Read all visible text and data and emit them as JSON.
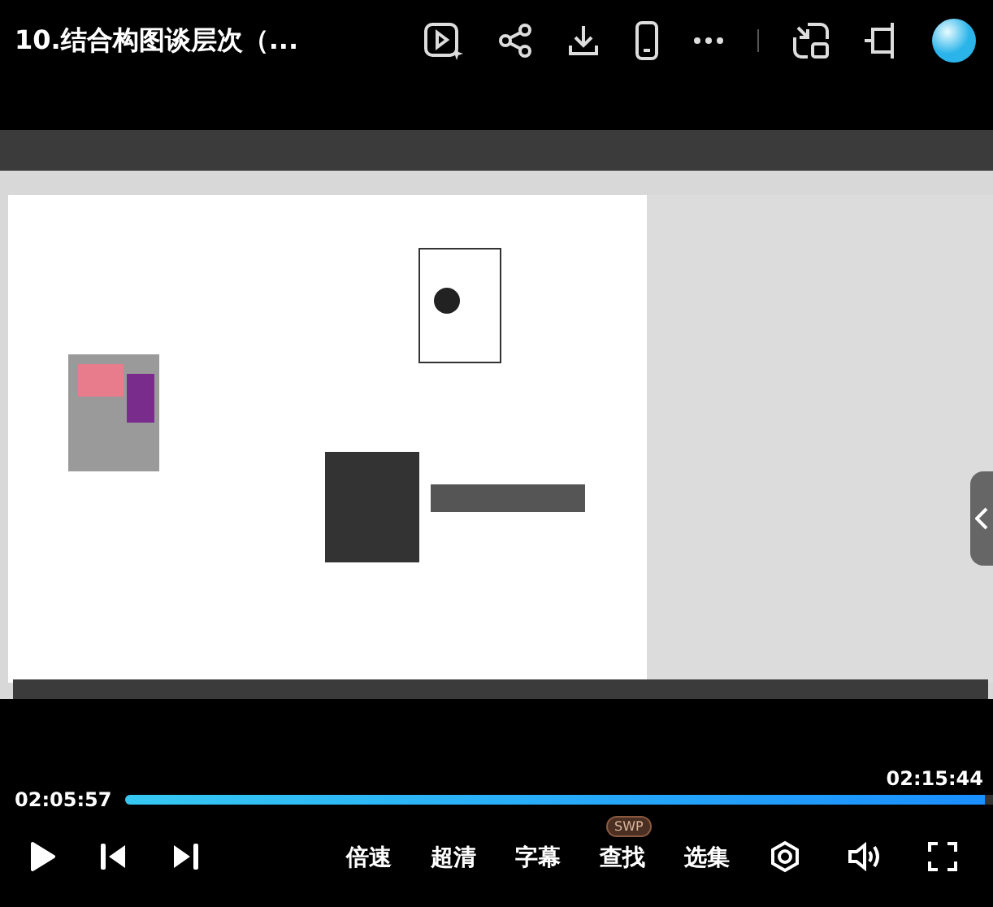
{
  "header": {
    "title": "10.结合构图谈层次（..."
  },
  "progress": {
    "current": "02:05:57",
    "total": "02:15:44",
    "level": 0.99
  },
  "controls": {
    "text_buttons": [
      {
        "label": "倍速"
      },
      {
        "label": "超清"
      },
      {
        "label": "字幕"
      },
      {
        "label": "查找",
        "badge": "SWP"
      },
      {
        "label": "选集"
      }
    ]
  }
}
